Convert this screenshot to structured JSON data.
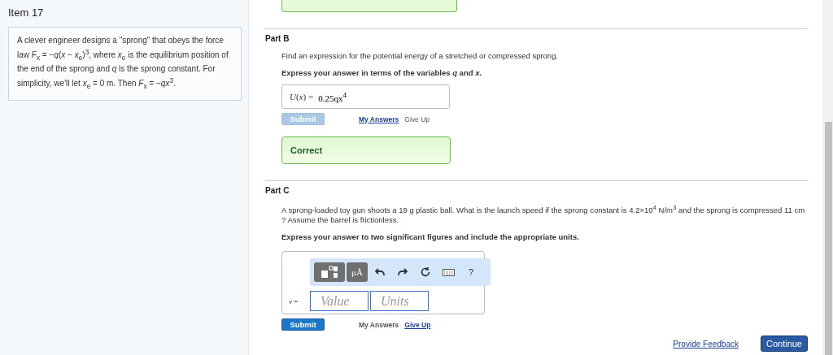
{
  "item": {
    "title": "Item 17",
    "problem": "A clever engineer designs a \"sprong\" that obeys the force law *F*$_{x}$ = −*q*(*x* − *x*$_{e}$)$^{3}$, where *x*$_{e}$ is the equilibrium position of the end of the sprong and *q* is the sprong constant. For simplicity, we'll let *x*$_{e}$ = 0 m. Then *F*$_{x}$ = −*qx*$^{3}$."
  },
  "parts": [
    {
      "kind": "answered",
      "title": "Part B",
      "question": "Find an expression for the potential energy of a stretched or compressed sprong.",
      "instruction": "Express your answer in terms of the variables *q* and *x*.",
      "answer_label": "*U*(*x*) =",
      "answer": "0.25qx$^{4}$",
      "submit": {
        "label": "Submit",
        "disabled": true
      },
      "my_answers": "My Answers",
      "give_up": "Give Up",
      "my_answers_link": true,
      "give_up_link": false,
      "feedback": "Correct"
    },
    {
      "kind": "open",
      "title": "Part C",
      "question": "A sprong-loaded toy gun shoots a 19 g plastic ball. What is the launch speed if the sprong constant is 4.2×10$^{4}$ N/m$^{3}$ and the sprong is compressed 11 cm ? Assume the barrel is frictionless.",
      "instruction": "Express your answer to two significant figures and include the appropriate units.",
      "toolbar": {
        "units_button": "μÅ",
        "help": "?"
      },
      "answer_label": "*v* =",
      "value_placeholder": "Value",
      "units_placeholder": "Units",
      "submit": {
        "label": "Submit",
        "disabled": false
      },
      "my_answers": "My Answers",
      "give_up": "Give Up",
      "my_answers_link": false,
      "give_up_link": true
    }
  ],
  "footer": {
    "feedback_link": "Provide Feedback",
    "continue": "Continue"
  }
}
